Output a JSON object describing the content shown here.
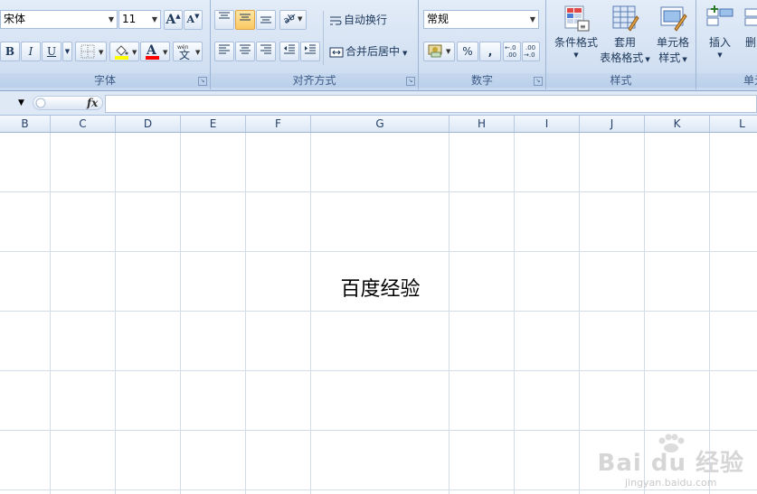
{
  "ribbon": {
    "font": {
      "name_value": "宋体",
      "size_value": "11",
      "grow_label": "A",
      "shrink_label": "A",
      "bold_label": "B",
      "italic_label": "I",
      "underline_label": "U",
      "fill_label": "◇",
      "color_label": "A",
      "phonetic_label": "文",
      "phonetic_top": "wén",
      "group_label": "字体"
    },
    "alignment": {
      "wrap_text_label": "自动换行",
      "merge_center_label": "合并后居中",
      "group_label": "对齐方式"
    },
    "number": {
      "format_value": "常规",
      "percent_label": "%",
      "comma_label": ",",
      "inc_decimal_label": "+.0 .00",
      "dec_decimal_label": ".00 →.0",
      "group_label": "数字"
    },
    "styles": {
      "conditional_label": "条件格式",
      "table_line1": "套用",
      "table_line2": "表格格式",
      "cell_line1": "单元格",
      "cell_line2": "样式",
      "group_label": "样式"
    },
    "cells": {
      "insert_label": "插入",
      "delete_label": "删",
      "group_label": "单元"
    },
    "colors": {
      "accent": "#1e395b",
      "fill_yellow": "#ffff00",
      "font_red": "#ff0000",
      "active": "#fbc963"
    }
  },
  "formula_bar": {
    "fx_label": "fx",
    "formula_value": ""
  },
  "sheet": {
    "columns": [
      "B",
      "C",
      "D",
      "E",
      "F",
      "G",
      "H",
      "I",
      "J",
      "K",
      "L"
    ],
    "cells": [
      {
        "ref": "G3",
        "value": "百度经验"
      }
    ]
  },
  "watermark": {
    "brand": "Bai du 经验",
    "url": "jingyan.baidu.com"
  }
}
